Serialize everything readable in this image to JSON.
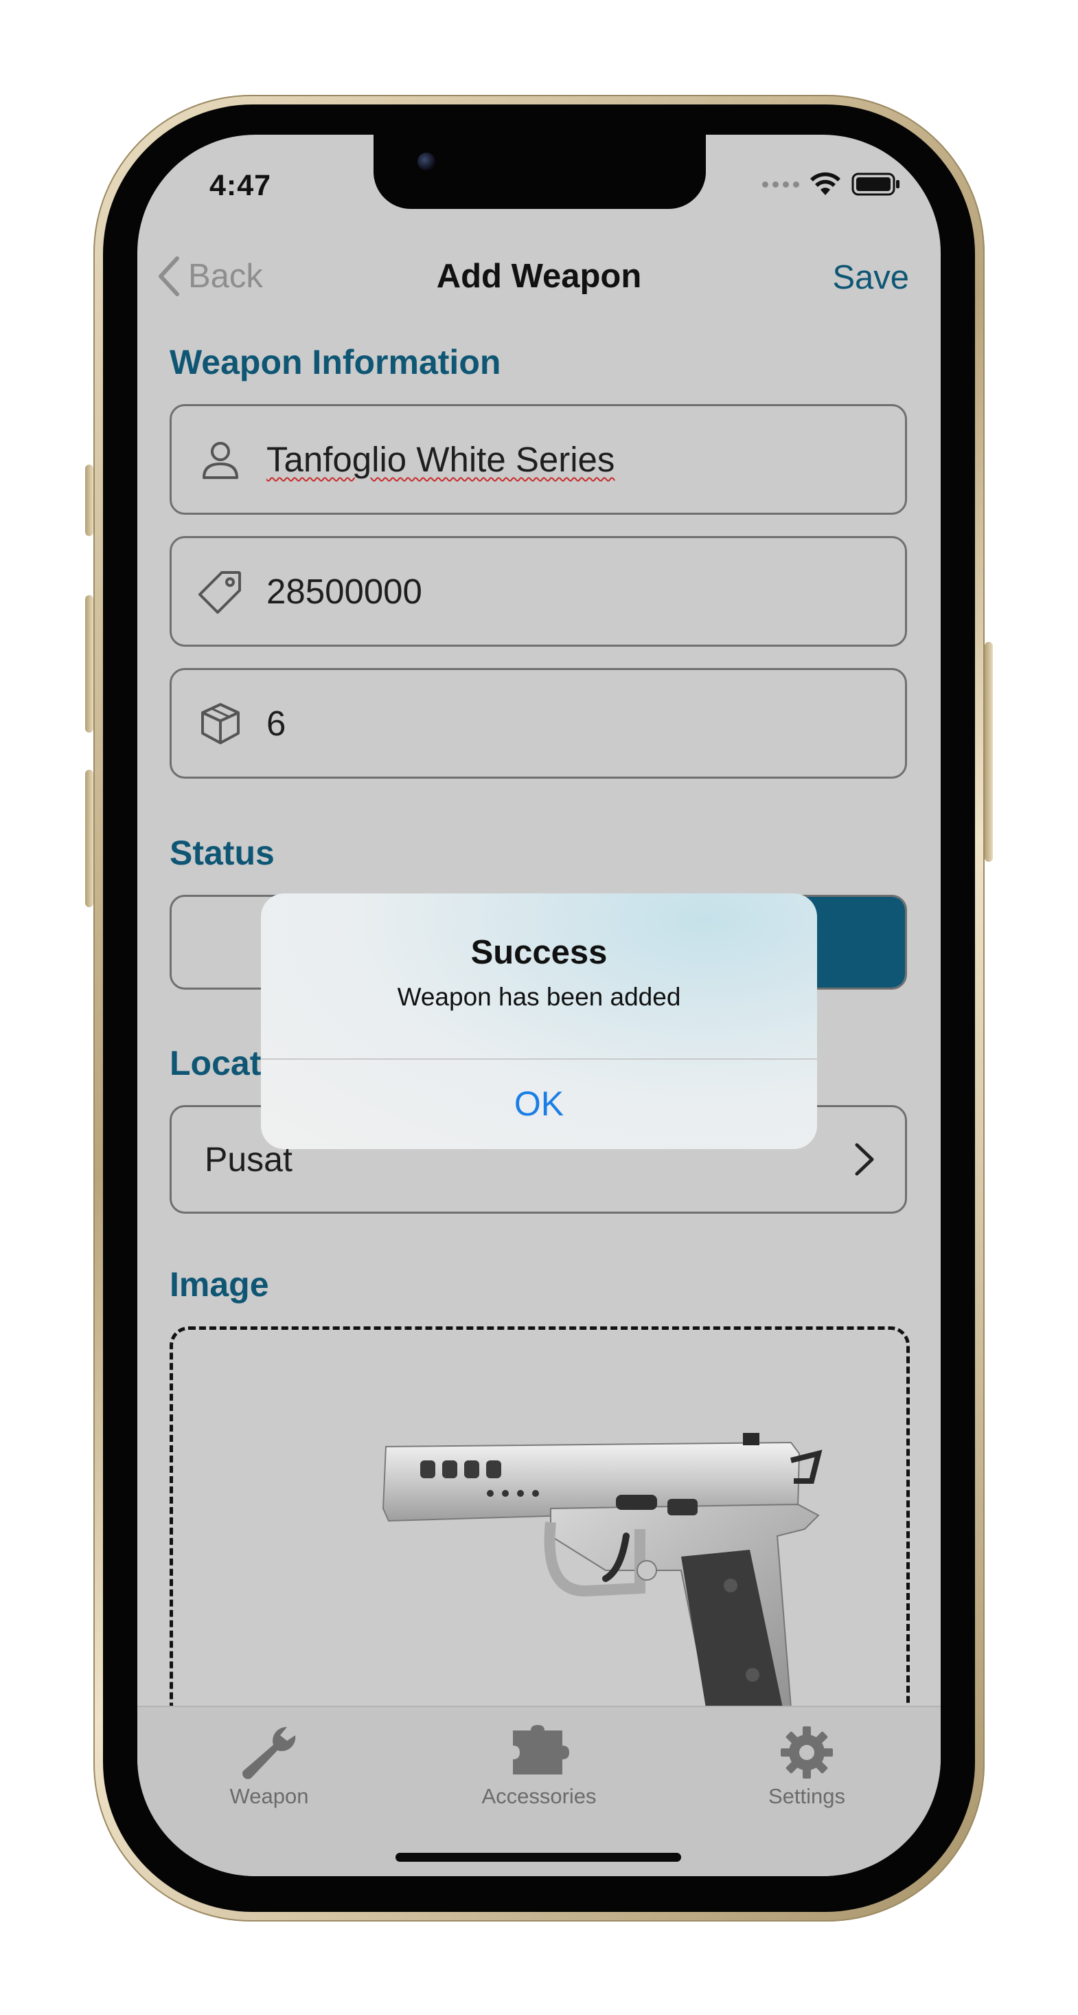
{
  "status_bar": {
    "time": "4:47"
  },
  "nav": {
    "back_label": "Back",
    "title": "Add Weapon",
    "save_label": "Save"
  },
  "weapon_info": {
    "section_title": "Weapon Information",
    "name": "Tanfoglio White Series",
    "price": "28500000",
    "quantity": "6"
  },
  "status": {
    "section_title": "Status"
  },
  "location": {
    "section_title": "Location",
    "value": "Pusat"
  },
  "image": {
    "section_title": "Image"
  },
  "tabs": [
    {
      "label": "Weapon",
      "icon": "wrench-icon"
    },
    {
      "label": "Accessories",
      "icon": "puzzle-icon"
    },
    {
      "label": "Settings",
      "icon": "gear-icon"
    }
  ],
  "alert": {
    "title": "Success",
    "message": "Weapon has been added",
    "ok_label": "OK"
  },
  "colors": {
    "accent": "#0e5674",
    "ios_blue": "#1a7ee6",
    "screen_bg": "#cbcbcb"
  }
}
